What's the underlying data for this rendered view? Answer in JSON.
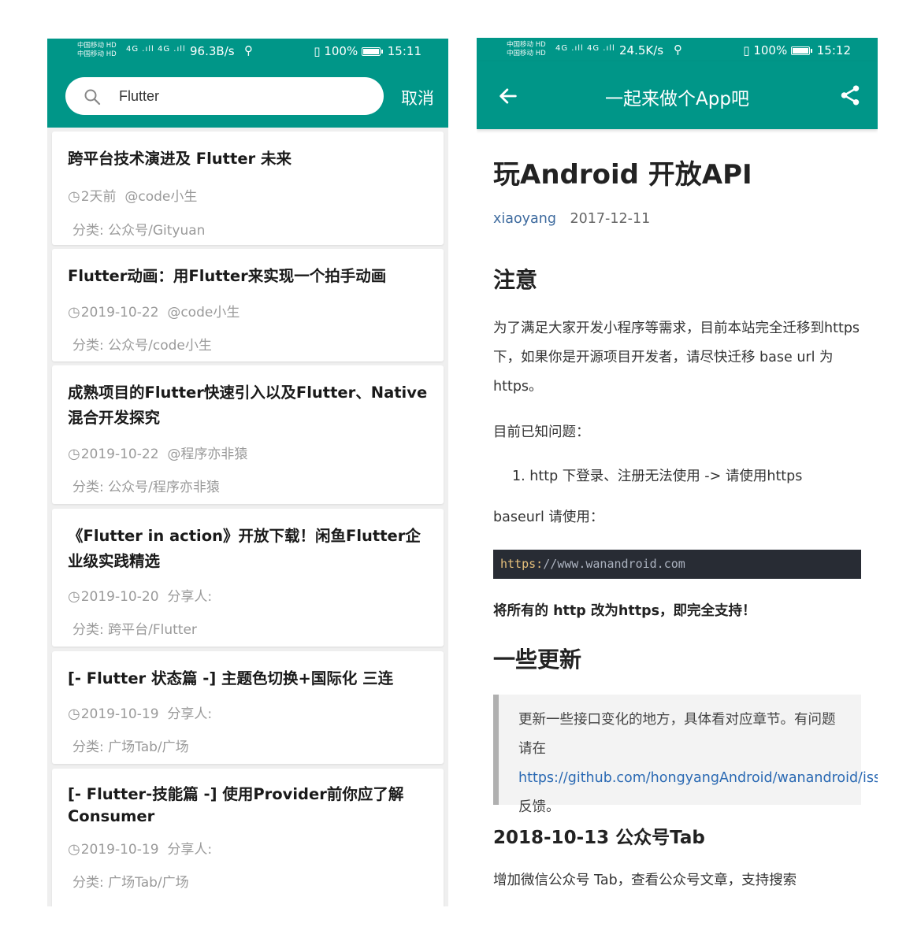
{
  "left": {
    "status": {
      "carrier1": "中国移动 HD",
      "carrier2": "中国移动 HD",
      "signal": "4G .ıll 4G .ıll",
      "speed": "96.3B/s",
      "usb": "⚲",
      "vibrate": "▯",
      "battery": "100%",
      "battery_level": 1.0,
      "time": "15:11"
    },
    "search": {
      "icon": "search-icon",
      "value": "Flutter",
      "cancel": "取消"
    },
    "articles": [
      {
        "title": "跨平台技术演进及 Flutter 未来",
        "time": "2天前",
        "author": "@code小生",
        "category": "分类: 公众号/Gityuan"
      },
      {
        "title": "Flutter动画：用Flutter来实现一个拍手动画",
        "time": "2019-10-22",
        "author": "@code小生",
        "category": "分类: 公众号/code小生"
      },
      {
        "title": "成熟项目的Flutter快速引入以及Flutter、Native混合开发探究",
        "time": "2019-10-22",
        "author": "@程序亦非猿",
        "category": "分类: 公众号/程序亦非猿"
      },
      {
        "title": "《Flutter in action》开放下载！闲鱼Flutter企业级实践精选",
        "time": "2019-10-20",
        "author": "分享人:",
        "category": "分类: 跨平台/Flutter"
      },
      {
        "title": "[- Flutter 状态篇 -] 主题色切换+国际化 三连",
        "time": "2019-10-19",
        "author": "分享人:",
        "category": "分类: 广场Tab/广场"
      },
      {
        "title": "[- Flutter-技能篇 -] 使用Provider前你应了解Consumer",
        "time": "2019-10-19",
        "author": "分享人:",
        "category": "分类: 广场Tab/广场"
      }
    ],
    "clock_glyph": "◷"
  },
  "right": {
    "status": {
      "carrier1": "中国移动 HD",
      "carrier2": "中国移动 HD",
      "signal": "4G .ıll 4G .ıll",
      "speed": "24.5K/s",
      "usb": "⚲",
      "vibrate": "▯",
      "battery": "100%",
      "battery_level": 1.0,
      "time": "15:12"
    },
    "appbar": {
      "back_icon": "arrow-left-icon",
      "title": "一起来做个App吧",
      "share_icon": "share-icon"
    },
    "article": {
      "title": "玩Android 开放API",
      "author": "xiaoyang",
      "date": "2017-12-11",
      "h_notice": "注意",
      "p1": "为了满足大家开发小程序等需求，目前本站完全迁移到https下，如果你是开源项目开发者，请尽快迁移 base url 为 https。",
      "p2": "目前已知问题：",
      "li1": "1. http 下登录、注册无法使用 -> 请使用https",
      "p3": "baseurl 请使用：",
      "code_proto": "https:",
      "code_rest": "//www.wanandroid.com",
      "bold": "将所有的 http 改为https，即完全支持！",
      "h_updates": "一些更新",
      "quote_pre": "更新一些接口变化的地方，具体看对应章节。有问题请在",
      "quote_link": "https://github.com/hongyangAndroid/wanandroid/issues",
      "quote_post": "反馈。",
      "h3": "2018-10-13 公众号Tab",
      "p4": "增加微信公众号 Tab，查看公众号文章，支持搜索"
    }
  },
  "colors": {
    "primary": "#009688",
    "link": "#2a69b3",
    "author": "#3d6a9e",
    "meta": "#9a9a9a"
  }
}
